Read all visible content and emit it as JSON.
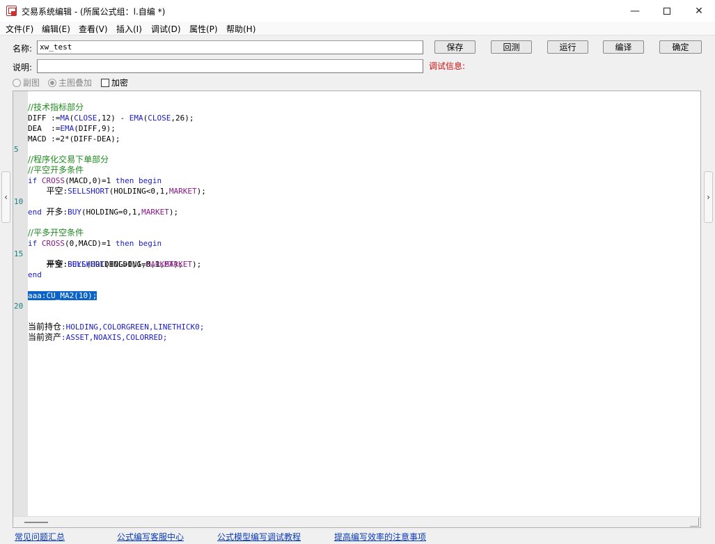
{
  "window": {
    "title": "交易系统编辑 - (所属公式组：l.自编 *)",
    "minimize": "—",
    "close": "✕"
  },
  "menu": [
    "文件(F)",
    "编辑(E)",
    "查看(V)",
    "插入(I)",
    "调试(D)",
    "属性(P)",
    "帮助(H)"
  ],
  "form": {
    "name_label": "名称:",
    "name_value": "xw_test",
    "desc_label": "说明:",
    "desc_value": "",
    "debug_label": "调试信息:"
  },
  "buttons": {
    "save": "保存",
    "backtest": "回测",
    "run": "运行",
    "compile": "编译",
    "ok": "确定"
  },
  "options": {
    "sub_chart": "副图",
    "main_overlay": "主图叠加",
    "encrypt": "加密"
  },
  "editor": {
    "line_numbers": {
      "5": "5",
      "10": "10",
      "15": "15",
      "20": "20"
    },
    "lines": {
      "l1": [
        "//技术指标部分"
      ],
      "l2": [
        "DIFF :=",
        "MA",
        "(",
        "CLOSE",
        ",12) - ",
        "EMA",
        "(",
        "CLOSE",
        ",26);"
      ],
      "l3": [
        "DEA  :=",
        "EMA",
        "(DIFF,9);"
      ],
      "l4": [
        "MACD :=2*(DIFF-DEA);"
      ],
      "l6": [
        "//程序化交易下单部分"
      ],
      "l7": [
        "//平空开多条件"
      ],
      "l8": [
        "if ",
        "CROSS",
        "(MACD,0)=1 ",
        "then",
        " ",
        "begin"
      ],
      "l9": [
        "    ",
        "平空",
        ":",
        "SELLSHORT",
        "(HOLDING<0,1,",
        "MARKET",
        ");"
      ],
      "l10": [
        "    ",
        "开多",
        ":",
        "BUY",
        "(HOLDING=0,1,",
        "MARKET",
        ");"
      ],
      "l11": [
        "end"
      ],
      "l13": [
        "//平多开空条件"
      ],
      "l14": [
        "if ",
        "CROSS",
        "(0,MACD)=1 ",
        "then",
        " ",
        "begin"
      ],
      "l15": [
        "    ",
        "平多",
        ":",
        "SELL",
        "(HOLDING>0,1,",
        "MARKET",
        ");"
      ],
      "l16": [
        "    ",
        "开空",
        ":",
        "BUYSHORT",
        "(HOLDING=0,1,",
        "MARKET",
        ");"
      ],
      "l17": [
        "end"
      ],
      "l19": [
        "aaa:CU_MA2(10);"
      ],
      "l22": [
        "当前持仓",
        ":HOLDING,COLORGREEN,LINETHICK0;"
      ],
      "l23": [
        "当前资产",
        ":ASSET,NOAXIS,COLORRED;"
      ]
    }
  },
  "footer_links": [
    "常见问题汇总",
    "公式编写客服中心",
    "公式模型编写调试教程",
    "提高编写效率的注意事项"
  ],
  "colors": {
    "comment": "#1e8a1e",
    "function": "#1a1acc",
    "constant": "#8a1a8a",
    "selection": "#0a64c8",
    "line_number": "#178080",
    "debug_label": "#d01010",
    "link": "#0a3ab8"
  }
}
